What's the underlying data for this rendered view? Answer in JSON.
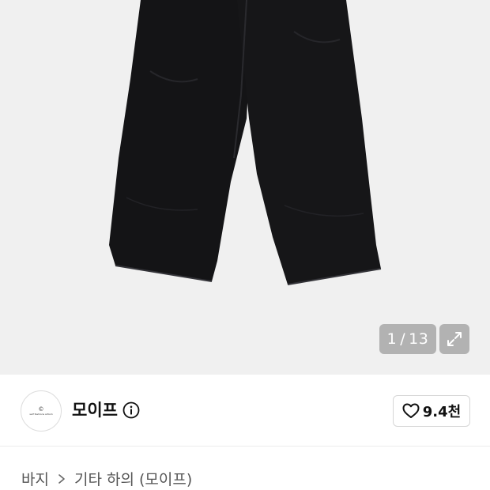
{
  "gallery": {
    "image_description_icon": "black-wide-pants-photo",
    "counter": {
      "current": "1",
      "separator": "/",
      "total": "13"
    },
    "expand_icon": "expand-arrows-icon",
    "background_color": "#f0f0f0",
    "garment_color": "#141416"
  },
  "seller": {
    "avatar_mark": "©",
    "avatar_text": "self fashions artism",
    "name": "모이프",
    "info_icon": "info-icon",
    "like_icon": "heart-outline-icon",
    "like_count": "9.4천"
  },
  "breadcrumb": {
    "items": [
      "바지",
      "기타 하의 (모이프)"
    ],
    "separator_icon": "chevron-right-icon"
  }
}
